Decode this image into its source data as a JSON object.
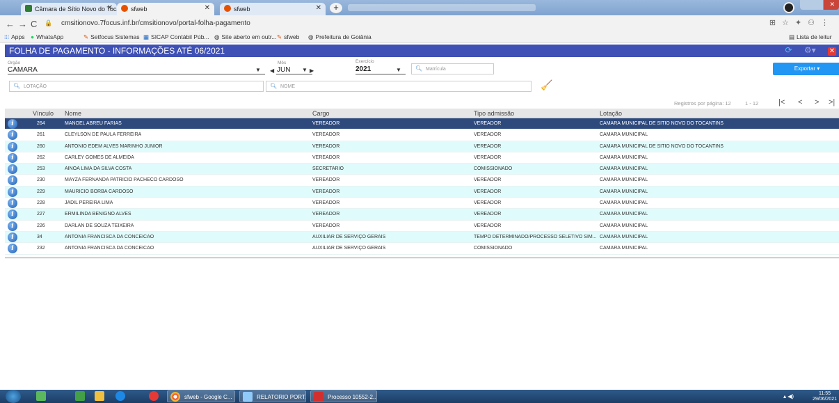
{
  "browser": {
    "tabs": [
      {
        "label": "Câmara de Sítio Novo do Tocant"
      },
      {
        "label": "sfweb"
      },
      {
        "label": "sfweb"
      }
    ],
    "url": "cmsitionovo.7focus.inf.br/cmsitionovo/portal-folha-pagamento",
    "bookmarks": [
      "Apps",
      "WhatsApp",
      "Setfocus Sistemas",
      "SICAP Contábil Púb...",
      "Site aberto em outr...",
      "sfweb",
      "Prefeitura de Goiânia"
    ],
    "reading_list": "Lista de leitur"
  },
  "app": {
    "title": "FOLHA DE PAGAMENTO - INFORMAÇÕES ATÉ 06/2021"
  },
  "filters": {
    "orgao_label": "Orgão",
    "orgao_value": "CAMARA",
    "mes_label": "Mês",
    "mes_value": "JUN",
    "exercicio_label": "Exercício",
    "exercicio_value": "2021",
    "matricula_placeholder": "Matrícula",
    "lotacao_placeholder": "LOTAÇÃO",
    "nome_placeholder": "NOME",
    "export_label": "Exportar"
  },
  "pager": {
    "per_page_label": "Registros por página: 12",
    "range": "1 - 12"
  },
  "table": {
    "headers": {
      "vinculo": "Vínculo",
      "nome": "Nome",
      "cargo": "Cargo",
      "tipo": "Tipo admissão",
      "lotacao": "Lotação"
    },
    "rows": [
      {
        "vinculo": "264",
        "nome": "MANOEL ABREU FARIAS",
        "cargo": "VEREADOR",
        "tipo": "VEREADOR",
        "lotacao": "CÂMARA MUNICIPAL DE SÍTIO NOVO DO TOCANTINS"
      },
      {
        "vinculo": "261",
        "nome": "CLEYLSON DE PAULA FERREIRA",
        "cargo": "VEREADOR",
        "tipo": "VEREADOR",
        "lotacao": "CÂMARA MUNICIPAL"
      },
      {
        "vinculo": "260",
        "nome": "ANTONIO EDEM ALVES MARINHO JUNIOR",
        "cargo": "VEREADOR",
        "tipo": "VEREADOR",
        "lotacao": "CÂMARA MUNICIPAL DE SÍTIO NOVO DO TOCANTINS"
      },
      {
        "vinculo": "262",
        "nome": "CARLEY GOMES DE ALMEIDA",
        "cargo": "VEREADOR",
        "tipo": "VEREADOR",
        "lotacao": "CÂMARA MUNICIPAL"
      },
      {
        "vinculo": "253",
        "nome": "AINOA LIMA DA SILVA COSTA",
        "cargo": "SECRETARIO",
        "tipo": "COMISSIONADO",
        "lotacao": "CÂMARA MUNICIPAL"
      },
      {
        "vinculo": "230",
        "nome": "MAYZA FERNANDA PATRICIO PACHECO CARDOSO",
        "cargo": "VEREADOR",
        "tipo": "VEREADOR",
        "lotacao": "CÂMARA MUNICIPAL"
      },
      {
        "vinculo": "229",
        "nome": "MAURICIO BORBA CARDOSO",
        "cargo": "VEREADOR",
        "tipo": "VEREADOR",
        "lotacao": "CÂMARA MUNICIPAL"
      },
      {
        "vinculo": "228",
        "nome": "JADIL PEREIRA LIMA",
        "cargo": "VEREADOR",
        "tipo": "VEREADOR",
        "lotacao": "CÂMARA MUNICIPAL"
      },
      {
        "vinculo": "227",
        "nome": "ERMILINDA BENIGNO ALVES",
        "cargo": "VEREADOR",
        "tipo": "VEREADOR",
        "lotacao": "CÂMARA MUNICIPAL"
      },
      {
        "vinculo": "226",
        "nome": "DARLAN DE SOUZA TEIXEIRA",
        "cargo": "VEREADOR",
        "tipo": "VEREADOR",
        "lotacao": "CÂMARA MUNICIPAL"
      },
      {
        "vinculo": "34",
        "nome": "ANTONIA FRANCISCA DA CONCEICAO",
        "cargo": "AUXILIAR DE SERVIÇO GERAIS",
        "tipo": "TEMPO DETERMINADO/PROCESSO SELETIVO SIM...",
        "lotacao": "CÂMARA MUNICIPAL"
      },
      {
        "vinculo": "232",
        "nome": "ANTONIA FRANCISCA DA CONCEICAO",
        "cargo": "AUXILIAR DE SERVIÇO GERAIS",
        "tipo": "COMISSIONADO",
        "lotacao": "CÂMARA MUNICIPAL"
      }
    ]
  },
  "taskbar": {
    "items": [
      "sfweb - Google C...",
      "RELATORIO PORT...",
      "Processo 10552-2..."
    ],
    "time": "11:55",
    "date": "29/06/2021"
  },
  "colors": {
    "header": "#3f51b5",
    "selected_row": "#2e4a7d",
    "alt_row": "#e0fbfb",
    "export": "#2196f3"
  }
}
